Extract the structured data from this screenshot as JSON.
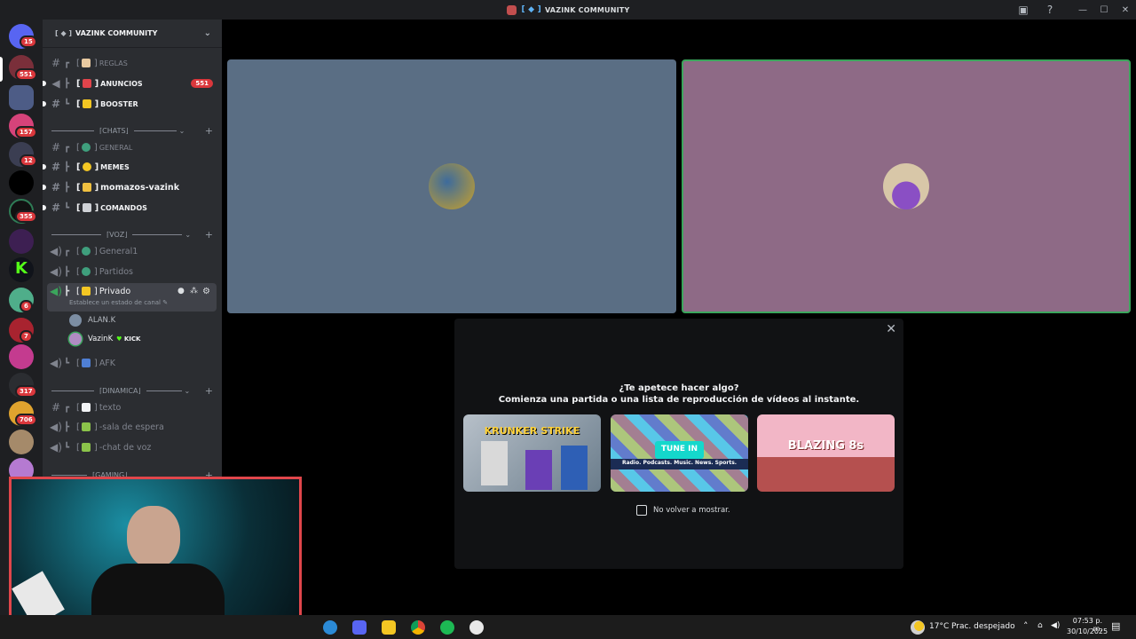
{
  "window": {
    "title": "VAZINK COMMUNITY"
  },
  "rail": {
    "badges": [
      "15",
      "551",
      "157",
      "12",
      "355",
      "6",
      "7",
      "317",
      "706"
    ]
  },
  "guild": {
    "name": "VAZINK COMMUNITY"
  },
  "channels": {
    "reglas": "REGLAS",
    "anuncios": "ANUNCIOS",
    "anuncios_badge": "551",
    "booster": "BOOSTER",
    "cat_chats": "CHATS",
    "general": "GENERAL",
    "memes": "MEMES",
    "momazos": "momazos-vazink",
    "comandos": "COMANDOS",
    "cat_voz": "VOZ",
    "general1": "General1",
    "partidos": "Partidos",
    "privado": "Privado",
    "privado_status": "Establece un estado de canal",
    "voice_users": [
      {
        "name": "ALAN.K"
      },
      {
        "name": "VazinK",
        "tag": "KICK"
      }
    ],
    "afk": "AFK",
    "cat_dinamica": "DINAMICA",
    "texto": "texto",
    "sala_espera": "-sala de espera",
    "chat_voz": "-chat de voz",
    "cat_gaming": "GAMING"
  },
  "activity": {
    "title": "¿Te apetece hacer algo?",
    "subtitle": "Comienza una partida o una lista de reproducción de vídeos al instante.",
    "cards": [
      {
        "name": "KRUNKER STRIKE"
      },
      {
        "name": "TUNE IN",
        "tagline": "Radio. Podcasts. Music. News. Sports."
      },
      {
        "name": "BLAZING 8s"
      }
    ],
    "checkbox_label": "No volver a mostrar."
  },
  "taskbar": {
    "weather_temp": "17°C",
    "weather_desc": "Prac. despejado",
    "time": "07:53 p. m.",
    "date": "30/10/2025"
  },
  "colors": {
    "accent": "#5865f2",
    "tile_left": "#5a6e84",
    "tile_right": "#8e6a86",
    "speaking": "#3ba55c",
    "badge": "#da373c",
    "webcam_border": "#e0464b"
  }
}
